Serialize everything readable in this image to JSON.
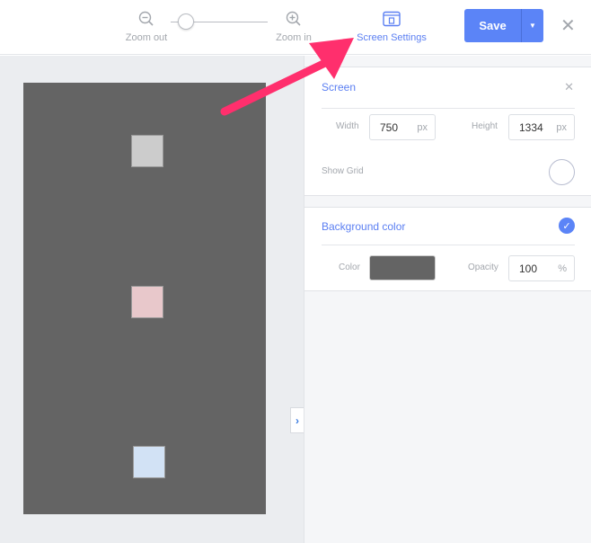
{
  "toolbar": {
    "zoom_out": "Zoom out",
    "zoom_in": "Zoom in",
    "screen_settings": "Screen Settings",
    "save": "Save",
    "zoom_level": 0.15
  },
  "canvas": {
    "background": "#646464",
    "squares": [
      {
        "color": "#cccccc"
      },
      {
        "color": "#e8c8cb"
      },
      {
        "color": "#d2e2f5"
      }
    ]
  },
  "panel": {
    "screen": {
      "title": "Screen",
      "width_label": "Width",
      "width_value": "750",
      "width_unit": "px",
      "height_label": "Height",
      "height_value": "1334",
      "height_unit": "px",
      "grid_label": "Show Grid",
      "grid_on": false
    },
    "background": {
      "title": "Background color",
      "enabled": true,
      "color_label": "Color",
      "color_value": "#646464",
      "opacity_label": "Opacity",
      "opacity_value": "100",
      "opacity_unit": "%"
    }
  },
  "colors": {
    "accent": "#5b84f7",
    "annotation_arrow": "#ff2f6d"
  }
}
